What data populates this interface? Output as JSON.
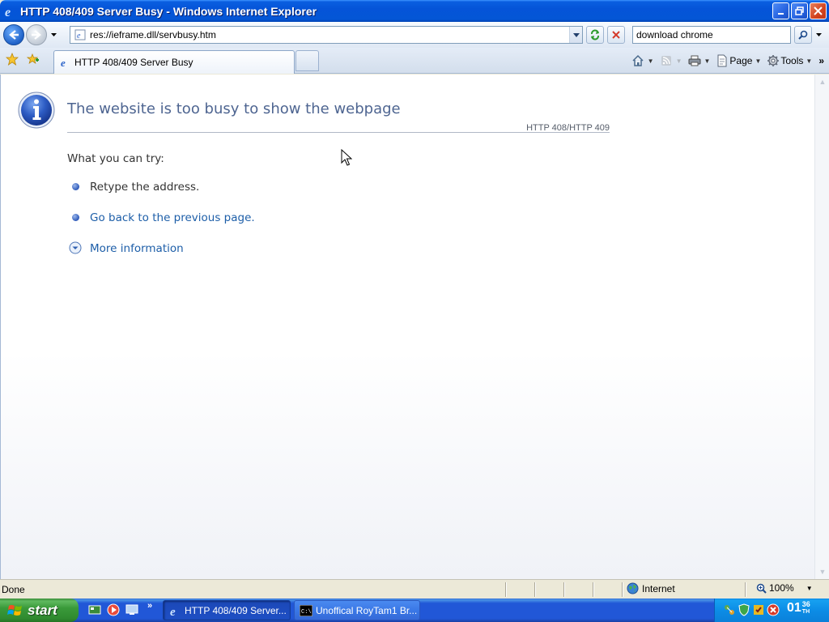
{
  "window": {
    "title": "HTTP 408/409 Server Busy - Windows Internet Explorer"
  },
  "navbar": {
    "address": "res://ieframe.dll/servbusy.htm",
    "search_value": "download chrome"
  },
  "tabbar": {
    "tab_label": "HTTP 408/409 Server Busy",
    "commands": {
      "page_label": "Page",
      "tools_label": "Tools"
    }
  },
  "content": {
    "title": "The website is too busy to show the webpage",
    "error_code": "HTTP 408/HTTP 409",
    "try_heading": "What you can try:",
    "items": [
      {
        "text": "Retype the address."
      },
      {
        "text": "Go back to the previous page."
      }
    ],
    "more_info": "More information"
  },
  "statusbar": {
    "status": "Done",
    "zone": "Internet",
    "zoom": "100%"
  },
  "taskbar": {
    "start_label": "start",
    "tasks": [
      {
        "label": "HTTP 408/409 Server..."
      },
      {
        "label": "Unoffical RoyTam1 Br..."
      }
    ],
    "clock_hour": "01",
    "clock_min": "36",
    "clock_suffix": "TH"
  },
  "colors": {
    "title_accent": "#4e6591",
    "link": "#1d5ea8",
    "titlebar_blue": "#0554d8",
    "start_green": "#3a9a3a"
  }
}
